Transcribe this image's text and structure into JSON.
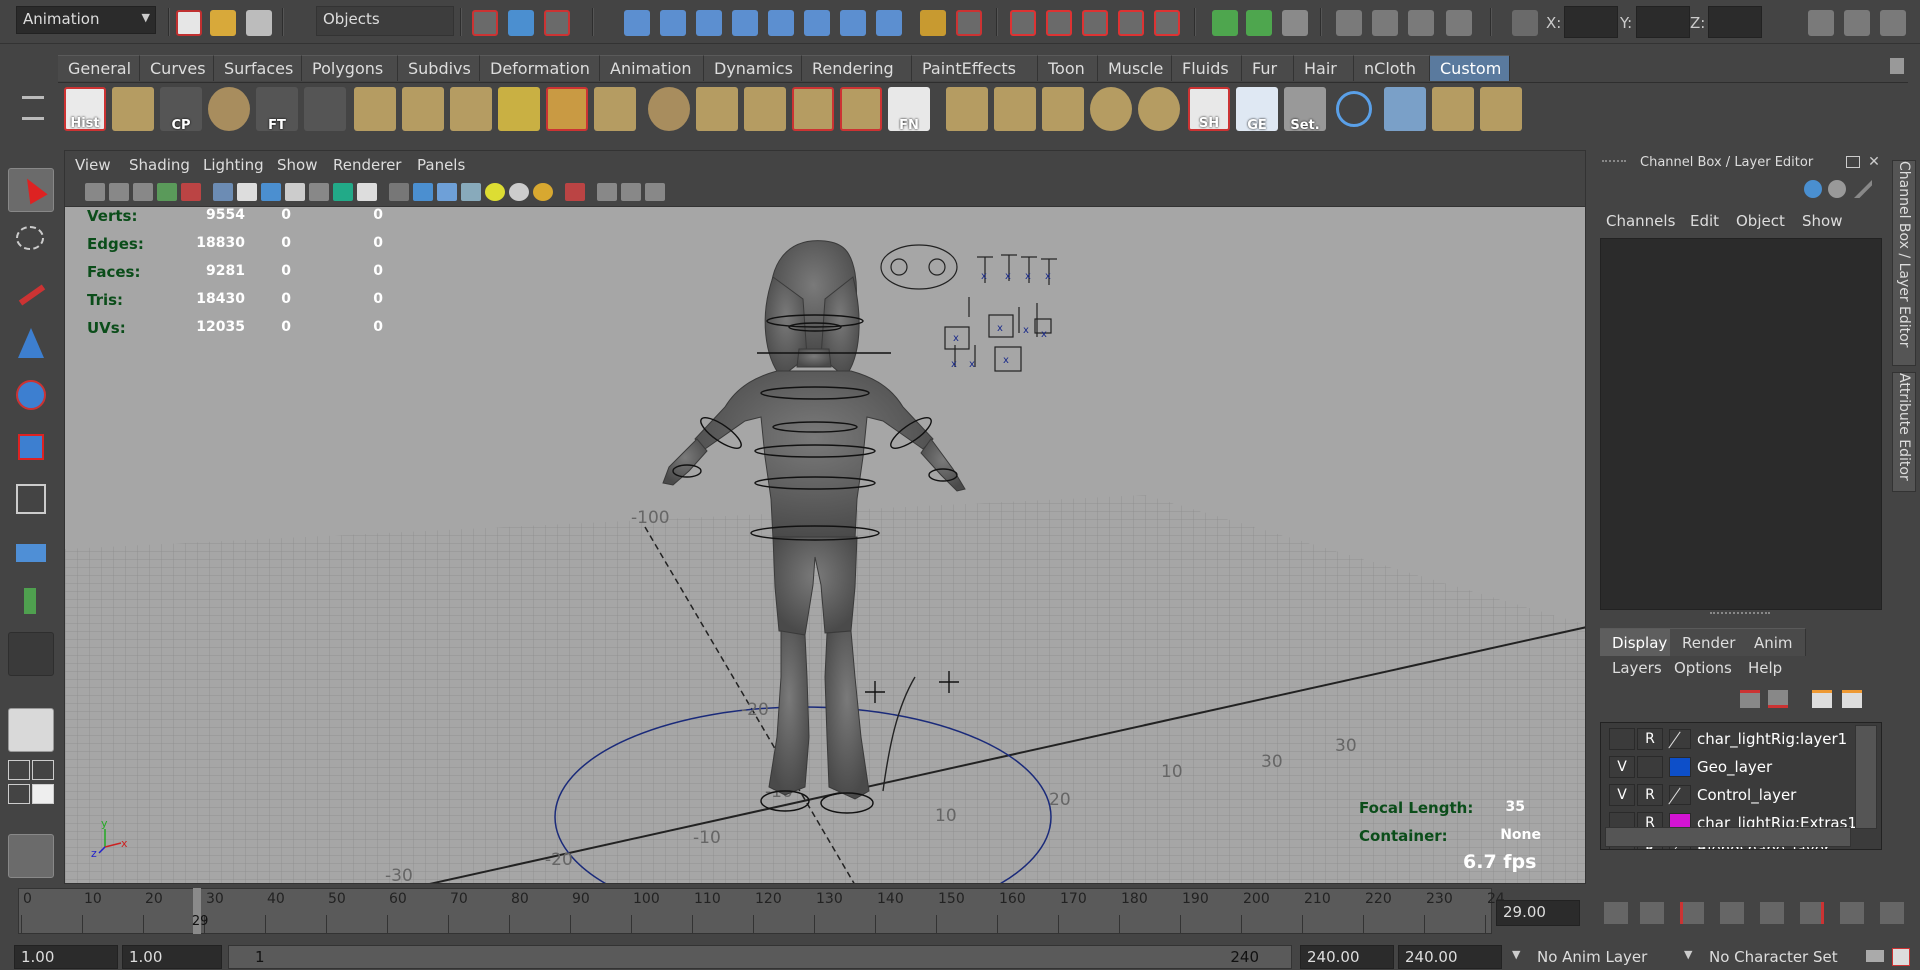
{
  "statusline": {
    "menuset": "Animation",
    "selection_mask": "Objects",
    "coords": {
      "x_label": "X:",
      "y_label": "Y:",
      "z_label": "Z:"
    }
  },
  "shelf": {
    "tabs": [
      "General",
      "Curves",
      "Surfaces",
      "Polygons",
      "Subdivs",
      "Deformation",
      "Animation",
      "Dynamics",
      "Rendering",
      "PaintEffects",
      "Toon",
      "Muscle",
      "Fluids",
      "Fur",
      "Hair",
      "nCloth",
      "Custom"
    ],
    "active_tab": "Custom",
    "button_labels": {
      "hist": "Hist",
      "cp": "CP",
      "ft": "FT",
      "fn": "FN",
      "sh": "SH",
      "ge": "GE",
      "set": "Set."
    }
  },
  "viewport": {
    "menus": [
      "View",
      "Shading",
      "Lighting",
      "Show",
      "Renderer",
      "Panels"
    ],
    "hud": {
      "rows": [
        {
          "label": "Verts:",
          "value": "9554",
          "sel": "0",
          "comp": "0"
        },
        {
          "label": "Edges:",
          "value": "18830",
          "sel": "0",
          "comp": "0"
        },
        {
          "label": "Faces:",
          "value": "9281",
          "sel": "0",
          "comp": "0"
        },
        {
          "label": "Tris:",
          "value": "18430",
          "sel": "0",
          "comp": "0"
        },
        {
          "label": "UVs:",
          "value": "12035",
          "sel": "0",
          "comp": "0"
        }
      ],
      "focal_length_label": "Focal Length:",
      "focal_length_value": "35",
      "container_label": "Container:",
      "container_value": "None",
      "fps": "6.7 fps"
    },
    "grid_labels": [
      "-100",
      "-20",
      "-10",
      "10",
      "20",
      "30",
      "30",
      "-10",
      "-20",
      "-30",
      "10"
    ]
  },
  "channel_box": {
    "title": "Channel Box / Layer Editor",
    "menus": [
      "Channels",
      "Edit",
      "Object",
      "Show"
    ]
  },
  "layer_editor": {
    "tabs": [
      "Display",
      "Render",
      "Anim"
    ],
    "active_tab": "Display",
    "menus": [
      "Layers",
      "Options",
      "Help"
    ],
    "layers": [
      {
        "v": "",
        "r": "R",
        "color": "",
        "name": "char_lightRig:layer1"
      },
      {
        "v": "V",
        "r": "",
        "color": "#0d4fc9",
        "name": "Geo_layer"
      },
      {
        "v": "V",
        "r": "R",
        "color": "",
        "name": "Control_layer"
      },
      {
        "v": "",
        "r": "R",
        "color": "#d414d4",
        "name": "char_lightRig:Extras1"
      },
      {
        "v": "",
        "r": "R",
        "color": "",
        "name": "Blendshape_layer"
      }
    ]
  },
  "side_tabs": [
    "Channel Box / Layer Editor",
    "Attribute Editor"
  ],
  "time_slider": {
    "ticks": [
      "0",
      "10",
      "20",
      "30",
      "40",
      "50",
      "60",
      "70",
      "80",
      "90",
      "100",
      "110",
      "120",
      "130",
      "140",
      "150",
      "160",
      "170",
      "180",
      "190",
      "200",
      "210",
      "220",
      "230",
      "24"
    ],
    "current_frame": 29,
    "current_frame_marker": "29",
    "current_frame_field": "29.00"
  },
  "range_slider": {
    "start_time": "1.00",
    "playback_start": "1.00",
    "range_start_label": "1",
    "range_end_label": "240",
    "playback_end": "240.00",
    "end_time": "240.00",
    "anim_layer": "No Anim Layer",
    "character_set": "No Character Set"
  }
}
